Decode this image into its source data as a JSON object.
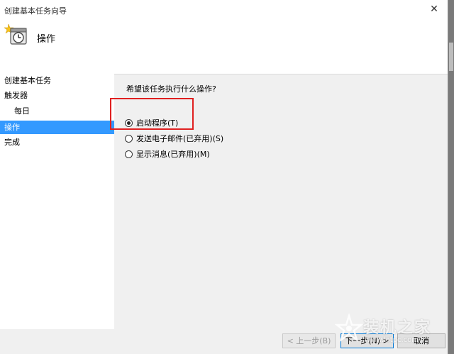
{
  "window": {
    "title": "创建基本任务向导",
    "close_glyph": "✕"
  },
  "header": {
    "title": "操作",
    "icon": "clock-task-icon"
  },
  "nav": {
    "items": [
      {
        "label": "创建基本任务",
        "sub": false,
        "selected": false
      },
      {
        "label": "触发器",
        "sub": false,
        "selected": false
      },
      {
        "label": "每日",
        "sub": true,
        "selected": false
      },
      {
        "label": "操作",
        "sub": false,
        "selected": true
      },
      {
        "label": "完成",
        "sub": false,
        "selected": false
      }
    ]
  },
  "main": {
    "question": "希望该任务执行什么操作?",
    "options": [
      {
        "label": "启动程序(T)",
        "checked": true
      },
      {
        "label": "发送电子邮件(已弃用)(S)",
        "checked": false
      },
      {
        "label": "显示消息(已弃用)(M)",
        "checked": false
      }
    ]
  },
  "footer": {
    "back_label": "< 上一步(B)",
    "next_label": "下一步(N) >",
    "cancel_label": "取消"
  },
  "watermark": {
    "text": "装机之家",
    "sub": "www.lotpc.com"
  },
  "colors": {
    "selection": "#3399ff",
    "highlight_box": "#e02020",
    "primary_border": "#0078d7"
  }
}
